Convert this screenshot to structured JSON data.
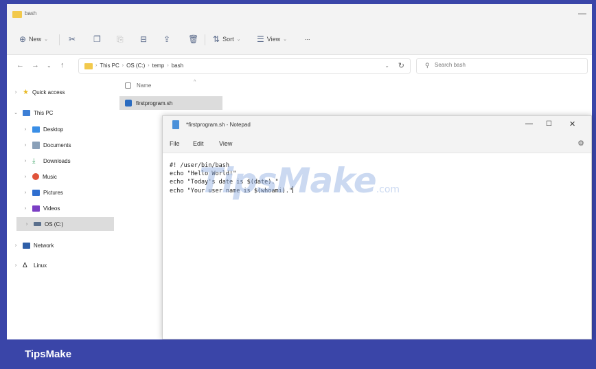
{
  "explorer": {
    "title": "bash",
    "toolbar": {
      "new_label": "New",
      "sort_label": "Sort",
      "view_label": "View",
      "more_label": "..."
    },
    "breadcrumb": [
      "This PC",
      "OS (C:)",
      "temp",
      "bash"
    ],
    "search_placeholder": "Search bash",
    "sidebar": {
      "items": [
        {
          "label": "Quick access"
        },
        {
          "label": "This PC"
        },
        {
          "label": "Desktop"
        },
        {
          "label": "Documents"
        },
        {
          "label": "Downloads"
        },
        {
          "label": "Music"
        },
        {
          "label": "Pictures"
        },
        {
          "label": "Videos"
        },
        {
          "label": "OS (C:)"
        },
        {
          "label": "Network"
        },
        {
          "label": "Linux"
        }
      ]
    },
    "column_name": "Name",
    "files": [
      {
        "name": "firstprogram.sh"
      }
    ]
  },
  "notepad": {
    "title": "*firstprogram.sh - Notepad",
    "menu": [
      "File",
      "Edit",
      "View"
    ],
    "lines": [
      "#! /user/bin/bash",
      "echo \"Hello World!\"",
      "echo \"Today's date is $(date).\"",
      "echo \"Your user name is $(whoami).\""
    ]
  },
  "watermark": {
    "text": "TipsMake",
    "suffix": ".com"
  },
  "footer": {
    "brand": "TipsMake"
  },
  "colors": {
    "accent": "#3a45a8",
    "selection": "#dcdcdc",
    "folder": "#f2c94c"
  }
}
